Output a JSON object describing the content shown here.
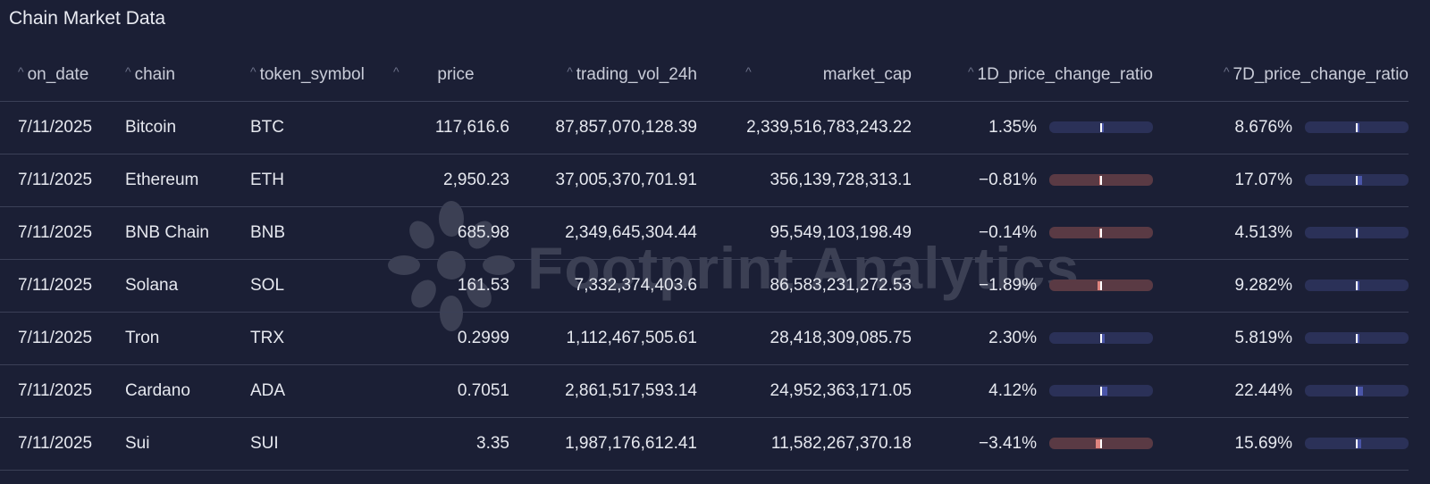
{
  "title": "Chain Market Data",
  "watermark": "Footprint Analytics",
  "columns": [
    "on_date",
    "chain",
    "token_symbol",
    "price",
    "trading_vol_24h",
    "market_cap",
    "1D_price_change_ratio",
    "7D_price_change_ratio"
  ],
  "rows": [
    {
      "on_date": "7/11/2025",
      "chain": "Bitcoin",
      "token_symbol": "BTC",
      "price": "117,616.6",
      "trading_vol_24h": "87,857,070,128.39",
      "market_cap": "2,339,516,783,243.22",
      "change_1d": "1.35%",
      "change_1d_value": 1.35,
      "change_7d": "8.676%",
      "change_7d_value": 8.676
    },
    {
      "on_date": "7/11/2025",
      "chain": "Ethereum",
      "token_symbol": "ETH",
      "price": "2,950.23",
      "trading_vol_24h": "37,005,370,701.91",
      "market_cap": "356,139,728,313.1",
      "change_1d": "−0.81%",
      "change_1d_value": -0.81,
      "change_7d": "17.07%",
      "change_7d_value": 17.07
    },
    {
      "on_date": "7/11/2025",
      "chain": "BNB Chain",
      "token_symbol": "BNB",
      "price": "685.98",
      "trading_vol_24h": "2,349,645,304.44",
      "market_cap": "95,549,103,198.49",
      "change_1d": "−0.14%",
      "change_1d_value": -0.14,
      "change_7d": "4.513%",
      "change_7d_value": 4.513
    },
    {
      "on_date": "7/11/2025",
      "chain": "Solana",
      "token_symbol": "SOL",
      "price": "161.53",
      "trading_vol_24h": "7,332,374,403.6",
      "market_cap": "86,583,231,272.53",
      "change_1d": "−1.89%",
      "change_1d_value": -1.89,
      "change_7d": "9.282%",
      "change_7d_value": 9.282
    },
    {
      "on_date": "7/11/2025",
      "chain": "Tron",
      "token_symbol": "TRX",
      "price": "0.2999",
      "trading_vol_24h": "1,112,467,505.61",
      "market_cap": "28,418,309,085.75",
      "change_1d": "2.30%",
      "change_1d_value": 2.3,
      "change_7d": "5.819%",
      "change_7d_value": 5.819
    },
    {
      "on_date": "7/11/2025",
      "chain": "Cardano",
      "token_symbol": "ADA",
      "price": "0.7051",
      "trading_vol_24h": "2,861,517,593.14",
      "market_cap": "24,952,363,171.05",
      "change_1d": "4.12%",
      "change_1d_value": 4.12,
      "change_7d": "22.44%",
      "change_7d_value": 22.44
    },
    {
      "on_date": "7/11/2025",
      "chain": "Sui",
      "token_symbol": "SUI",
      "price": "3.35",
      "trading_vol_24h": "1,987,176,612.41",
      "market_cap": "11,582,267,370.18",
      "change_1d": "−3.41%",
      "change_1d_value": -3.41,
      "change_7d": "15.69%",
      "change_7d_value": 15.69
    }
  ],
  "colors": {
    "positive_bar": "#2b3158",
    "positive_fill": "#4a55a8",
    "negative_bar": "#5a3a44",
    "negative_fill": "#e0857f"
  },
  "icons": {
    "sort": "sort-arrow-icon",
    "logo": "footprint-logo-icon"
  }
}
